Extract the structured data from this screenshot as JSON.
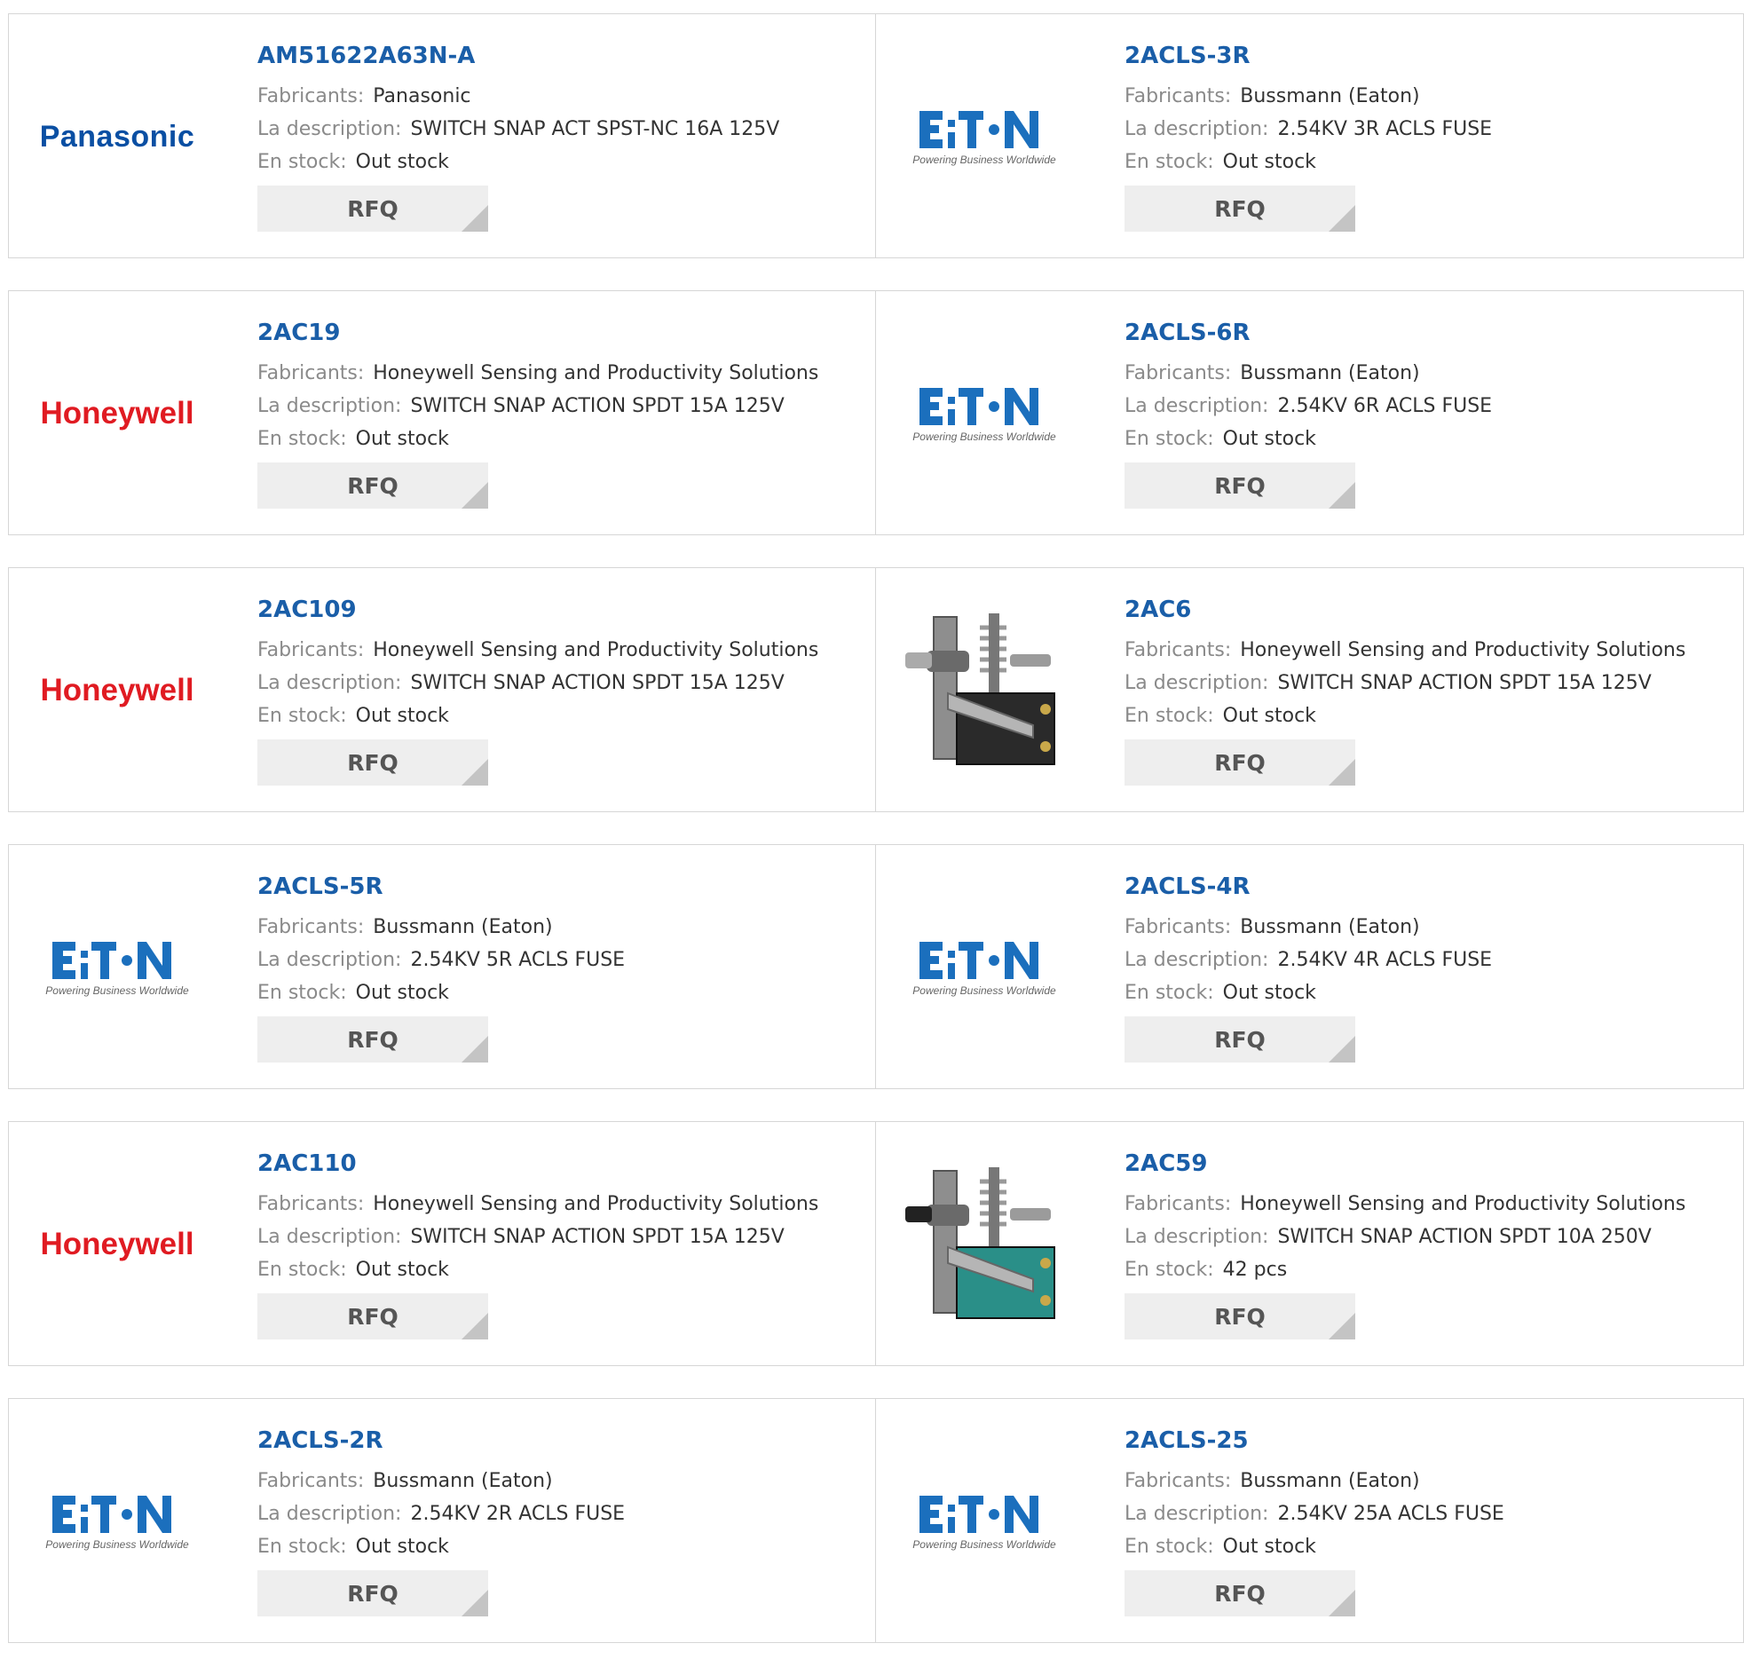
{
  "labels": {
    "manufacturer": "Fabricants:",
    "description": "La description:",
    "stock": "En stock:",
    "rfq": "RFQ"
  },
  "colors": {
    "part_link": "#1a5ea8",
    "label": "#8a8a8a",
    "panasonic": "#0a4fa3",
    "honeywell": "#e01b22",
    "eaton": "#1b6fbd"
  },
  "logo_text": {
    "panasonic": "Panasonic",
    "honeywell": "Honeywell",
    "eaton_tagline": "Powering Business Worldwide"
  },
  "products": [
    {
      "part": "AM51622A63N-A",
      "manufacturer": "Panasonic",
      "description": "SWITCH SNAP ACT SPST-NC 16A 125V",
      "stock": "Out stock",
      "logo": "panasonic"
    },
    {
      "part": "2ACLS-3R",
      "manufacturer": "Bussmann (Eaton)",
      "description": "2.54KV 3R ACLS FUSE",
      "stock": "Out stock",
      "logo": "eaton"
    },
    {
      "part": "2AC19",
      "manufacturer": "Honeywell Sensing and Productivity Solutions",
      "description": "SWITCH SNAP ACTION SPDT 15A 125V",
      "stock": "Out stock",
      "logo": "honeywell"
    },
    {
      "part": "2ACLS-6R",
      "manufacturer": "Bussmann (Eaton)",
      "description": "2.54KV 6R ACLS FUSE",
      "stock": "Out stock",
      "logo": "eaton"
    },
    {
      "part": "2AC109",
      "manufacturer": "Honeywell Sensing and Productivity Solutions",
      "description": "SWITCH SNAP ACTION SPDT 15A 125V",
      "stock": "Out stock",
      "logo": "honeywell"
    },
    {
      "part": "2AC6",
      "manufacturer": "Honeywell Sensing and Productivity Solutions",
      "description": "SWITCH SNAP ACTION SPDT 15A 125V",
      "stock": "Out stock",
      "logo": "switch-black"
    },
    {
      "part": "2ACLS-5R",
      "manufacturer": "Bussmann (Eaton)",
      "description": "2.54KV 5R ACLS FUSE",
      "stock": "Out stock",
      "logo": "eaton"
    },
    {
      "part": "2ACLS-4R",
      "manufacturer": "Bussmann (Eaton)",
      "description": "2.54KV 4R ACLS FUSE",
      "stock": "Out stock",
      "logo": "eaton"
    },
    {
      "part": "2AC110",
      "manufacturer": "Honeywell Sensing and Productivity Solutions",
      "description": "SWITCH SNAP ACTION SPDT 15A 125V",
      "stock": "Out stock",
      "logo": "honeywell"
    },
    {
      "part": "2AC59",
      "manufacturer": "Honeywell Sensing and Productivity Solutions",
      "description": "SWITCH SNAP ACTION SPDT 10A 250V",
      "stock": "42 pcs",
      "logo": "switch-teal"
    },
    {
      "part": "2ACLS-2R",
      "manufacturer": "Bussmann (Eaton)",
      "description": "2.54KV 2R ACLS FUSE",
      "stock": "Out stock",
      "logo": "eaton"
    },
    {
      "part": "2ACLS-25",
      "manufacturer": "Bussmann (Eaton)",
      "description": "2.54KV 25A ACLS FUSE",
      "stock": "Out stock",
      "logo": "eaton"
    }
  ]
}
